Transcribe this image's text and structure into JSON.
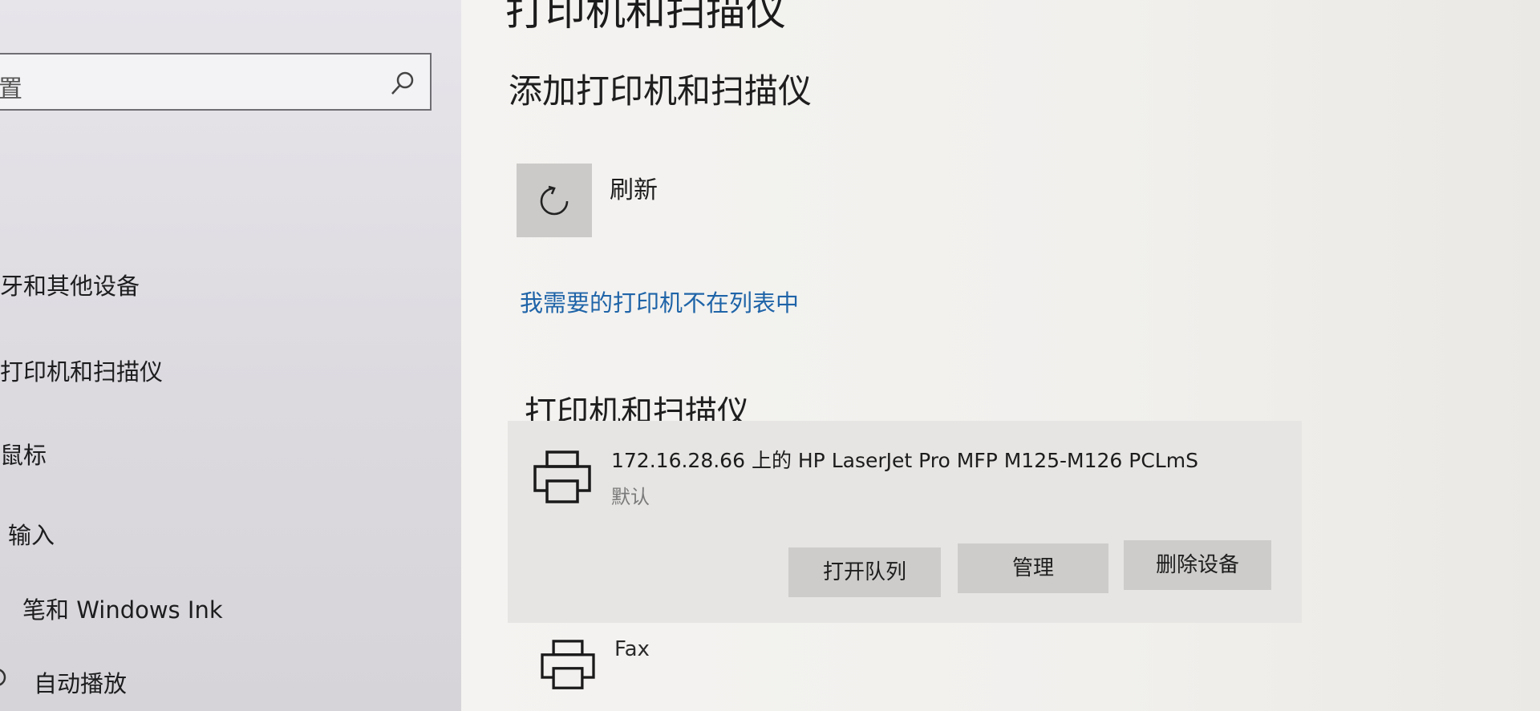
{
  "page": {
    "title": "打印机和扫描仪"
  },
  "sidebar": {
    "search": {
      "placeholder": "置"
    },
    "items": [
      {
        "label": "牙和其他设备"
      },
      {
        "label": "打印机和扫描仪"
      },
      {
        "label": "鼠标"
      },
      {
        "label": "输入"
      },
      {
        "label": "笔和 Windows Ink"
      },
      {
        "label": "自动播放"
      }
    ]
  },
  "add_section": {
    "title": "添加打印机和扫描仪",
    "refresh_label": "刷新",
    "link_label": "我需要的打印机不在列表中"
  },
  "printers_section": {
    "title": "打印机和扫描仪",
    "items": [
      {
        "name": "172.16.28.66 上的 HP LaserJet Pro MFP M125-M126 PCLmS",
        "status": "默认",
        "buttons": {
          "open_queue": "打开队列",
          "manage": "管理",
          "remove": "删除设备"
        }
      },
      {
        "name": "Fax"
      }
    ]
  },
  "icons": {
    "search": "search-icon",
    "refresh": "refresh-icon",
    "printer": "printer-icon"
  },
  "colors": {
    "link": "#1f64a8",
    "button_bg": "#cdccca",
    "card_bg": "#e6e5e3"
  }
}
